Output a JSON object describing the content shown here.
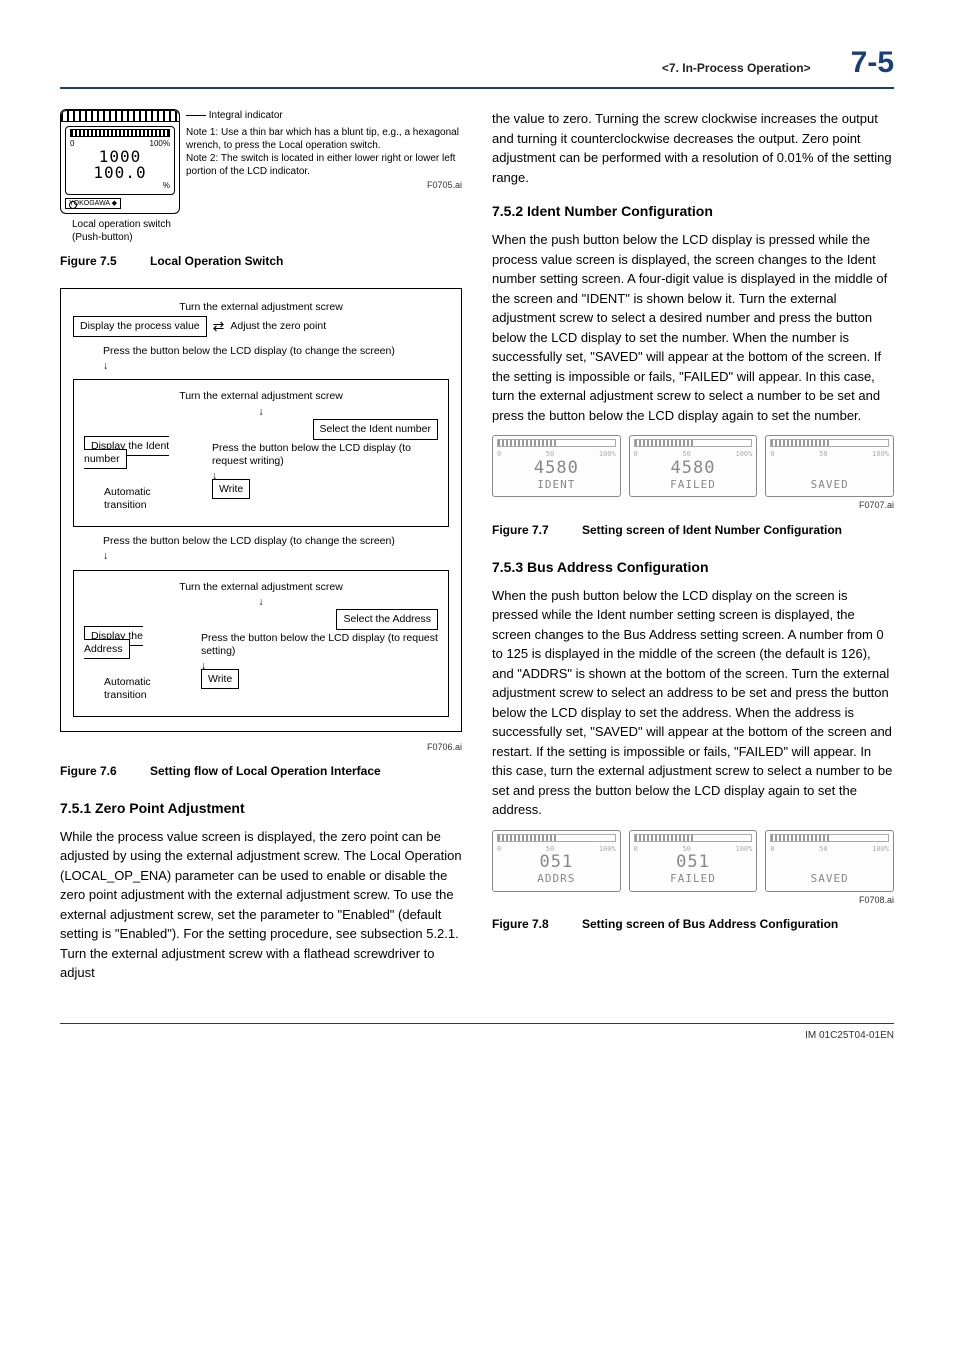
{
  "header": {
    "section": "<7.  In-Process Operation>",
    "pagenum": "7-5"
  },
  "fig75": {
    "integral": "Integral indicator",
    "note1": "Note 1: Use a thin bar which has a blunt tip, e.g., a hexagonal wrench, to press the Local operation switch.",
    "note2": "Note 2: The switch is located in either lower right or lower left portion of the LCD indicator.",
    "local_switch": "Local operation switch",
    "push_button": "(Push-button)",
    "fid": "F0705.ai",
    "caption_label": "Figure 7.5",
    "caption_text": "Local Operation Switch",
    "lcd_top": "1000",
    "lcd_big": "100.0",
    "lcd_pct": "%",
    "lcd_brand": "YOKOGAWA ◆",
    "scale0": "0",
    "scale100": "100%"
  },
  "flow": {
    "turn_ext": "Turn the external adjustment screw",
    "disp_process": "Display the process value",
    "adjust_zero": "Adjust the zero point",
    "press_change": "Press the button below the LCD display (to change the screen)",
    "select_ident": "Select the Ident number",
    "disp_ident": "Display the Ident number",
    "auto_trans": "Automatic transition",
    "press_write": "Press the button below the LCD display (to request writing)",
    "write": "Write",
    "select_addr": "Select the Address",
    "disp_addr": "Display the Address",
    "press_set": "Press the button below the LCD display (to request setting)",
    "fid": "F0706.ai",
    "caption_label": "Figure 7.6",
    "caption_text": "Setting flow of Local Operation Interface"
  },
  "s751": {
    "title": "7.5.1   Zero Point Adjustment",
    "body": "While the process value screen is displayed, the zero point can be adjusted by using the external adjustment screw. The Local Operation (LOCAL_OP_ENA) parameter can be used to enable or disable the zero point adjustment with the external adjustment screw. To use the external adjustment screw, set the parameter to \"Enabled\" (default setting is \"Enabled\"). For the setting procedure, see subsection 5.2.1. Turn the external adjustment screw with a flathead screwdriver to adjust"
  },
  "col2_intro": "the value to zero. Turning the screw clockwise increases the output and turning it counterclockwise decreases the output. Zero point adjustment can be performed with a resolution of 0.01% of the setting range.",
  "s752": {
    "title": "7.5.2   Ident Number Configuration",
    "body": "When the push button below the LCD display is pressed while the process value screen is displayed, the screen changes to the Ident number setting screen. A four-digit value is displayed in the middle of the screen and \"IDENT\" is shown below it. Turn the external adjustment screw to select a desired number and press the button below the LCD display to set the number. When the number is successfully set, \"SAVED\" will appear at the bottom of the screen. If the setting is impossible or fails, \"FAILED\" will appear. In this case, turn the external adjustment screw to select a number to be set and press the button below the LCD display again to set the number."
  },
  "fig77": {
    "v1": "4580",
    "l1": "IDENT",
    "v2": "4580",
    "l2": "FAILED",
    "v3": "",
    "l3": "SAVED",
    "fid": "F0707.ai",
    "caption_label": "Figure 7.7",
    "caption_text": "Setting screen of Ident Number Configuration"
  },
  "s753": {
    "title": "7.5.3   Bus Address Configuration",
    "body": "When the push button below the LCD display on the screen is pressed while the Ident number setting screen is displayed, the screen changes to the Bus Address setting screen. A number from 0 to 125 is displayed in the middle of the screen (the default is 126), and \"ADDRS\" is shown at the bottom of the screen. Turn the external adjustment screw to select an address to be set and press the button below the LCD display to set the address. When the address is successfully set, \"SAVED\" will appear at the bottom of the screen and restart. If the setting is impossible or fails, \"FAILED\" will appear. In this case, turn the external adjustment screw to select a number to be set and press the button below the LCD display again to set the address."
  },
  "fig78": {
    "v1": "051",
    "l1": "ADDRS",
    "v2": "051",
    "l2": "FAILED",
    "v3": "",
    "l3": "SAVED",
    "fid": "F0708.ai",
    "caption_label": "Figure 7.8",
    "caption_text": "Setting screen of Bus Address Configuration"
  },
  "lcd_scale": {
    "lo": "0",
    "mid": "50",
    "hi": "100%"
  },
  "footer": "IM 01C25T04-01EN"
}
